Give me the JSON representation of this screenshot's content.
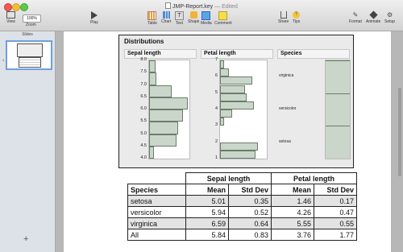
{
  "window": {
    "file_name": "JMP-Report.key",
    "edited_label": "Edited",
    "separator": " — "
  },
  "toolbar": {
    "view_label": "View",
    "zoom_label": "Zoom",
    "zoom_value": "100%",
    "play_label": "Play",
    "table_label": "Table",
    "chart_label": "Chart",
    "text_label": "Text",
    "shape_label": "Shape",
    "media_label": "Media",
    "comment_label": "Comment",
    "share_label": "Share",
    "tips_label": "Tips",
    "format_label": "Format",
    "animate_label": "Animate",
    "setup_label": "Setup"
  },
  "sidebar": {
    "header": "Slides",
    "slide_number": "1",
    "add_label": "+"
  },
  "distributions": {
    "title": "Distributions",
    "sepal_header": "Sepal length",
    "petal_header": "Petal length",
    "species_header": "Species",
    "sepal_ticks": [
      "8.0",
      "7.5",
      "7.0",
      "6.5",
      "6.0",
      "5.5",
      "5.0",
      "4.5",
      "4.0"
    ],
    "petal_ticks": [
      "7",
      "6",
      "5",
      "4",
      "3",
      "2",
      "1"
    ],
    "species_labels": [
      "virginica",
      "versicolor",
      "setosa"
    ]
  },
  "chart_data": [
    {
      "type": "bar",
      "title": "Sepal length",
      "orientation": "horizontal",
      "categories": [
        "4.0-4.5",
        "4.5-5.0",
        "5.0-5.5",
        "5.5-6.0",
        "6.0-6.5",
        "6.5-7.0",
        "7.0-7.5",
        "7.5-8.0"
      ],
      "values": [
        4,
        22,
        23,
        27,
        31,
        18,
        6,
        5
      ],
      "ylim": [
        4.0,
        8.0
      ]
    },
    {
      "type": "bar",
      "title": "Petal length",
      "orientation": "horizontal",
      "categories": [
        "1.0-1.5",
        "1.5-2.0",
        "2.0-2.5",
        "2.5-3.0",
        "3.0-3.5",
        "3.5-4.0",
        "4.0-4.5",
        "4.5-5.0",
        "5.0-5.5",
        "5.5-6.0",
        "6.0-6.5",
        "6.5-7.0"
      ],
      "values": [
        24,
        26,
        0,
        0,
        3,
        8,
        23,
        18,
        17,
        22,
        6,
        3
      ],
      "ylim": [
        1,
        7
      ]
    },
    {
      "type": "bar",
      "title": "Species",
      "categories": [
        "setosa",
        "versicolor",
        "virginica"
      ],
      "values": [
        50,
        50,
        50
      ]
    }
  ],
  "table": {
    "group_headers": [
      "Sepal length",
      "Petal length"
    ],
    "columns": [
      "Species",
      "Mean",
      "Std Dev",
      "Mean",
      "Std Dev"
    ],
    "rows": [
      {
        "species": "setosa",
        "s_mean": "5.01",
        "s_std": "0.35",
        "p_mean": "1.46",
        "p_std": "0.17"
      },
      {
        "species": "versicolor",
        "s_mean": "5.94",
        "s_std": "0.52",
        "p_mean": "4.26",
        "p_std": "0.47"
      },
      {
        "species": "virginica",
        "s_mean": "6.59",
        "s_std": "0.64",
        "p_mean": "5.55",
        "p_std": "0.55"
      },
      {
        "species": "All",
        "s_mean": "5.84",
        "s_std": "0.83",
        "p_mean": "3.76",
        "p_std": "1.77"
      }
    ]
  },
  "colors": {
    "bar_fill": "#c9d6c9",
    "bar_stroke": "#6b7d6b",
    "selection": "#6f9fe0"
  }
}
